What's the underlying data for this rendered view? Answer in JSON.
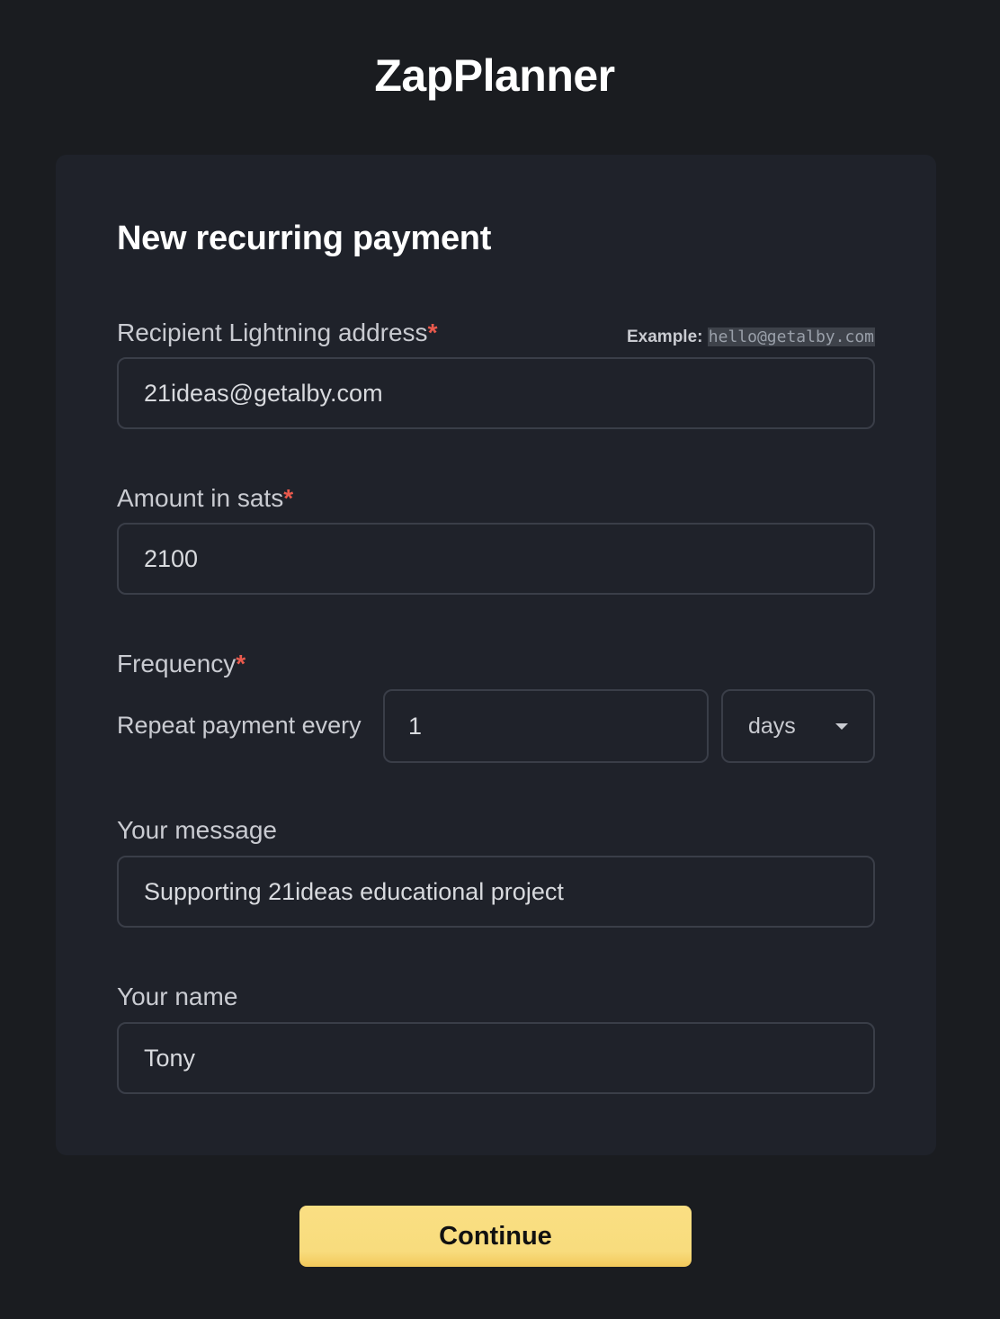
{
  "app": {
    "title": "ZapPlanner"
  },
  "form": {
    "title": "New recurring payment",
    "required_marker": "*",
    "recipient": {
      "label": "Recipient Lightning address",
      "example_prefix": "Example:",
      "example_value": "hello@getalby.com",
      "value": "21ideas@getalby.com"
    },
    "amount": {
      "label": "Amount in sats",
      "value": "2100"
    },
    "frequency": {
      "label": "Frequency",
      "repeat_label": "Repeat payment every",
      "value": "1",
      "unit": "days"
    },
    "message": {
      "label": "Your message",
      "value": "Supporting 21ideas educational project"
    },
    "name": {
      "label": "Your name",
      "value": "Tony"
    }
  },
  "actions": {
    "continue_label": "Continue"
  },
  "colors": {
    "background": "#1a1c20",
    "card": "#1f222a",
    "required": "#ea5a4d",
    "button": "#f8dc7d"
  },
  "icons": {
    "select_chevron": "chevron-down-icon"
  }
}
